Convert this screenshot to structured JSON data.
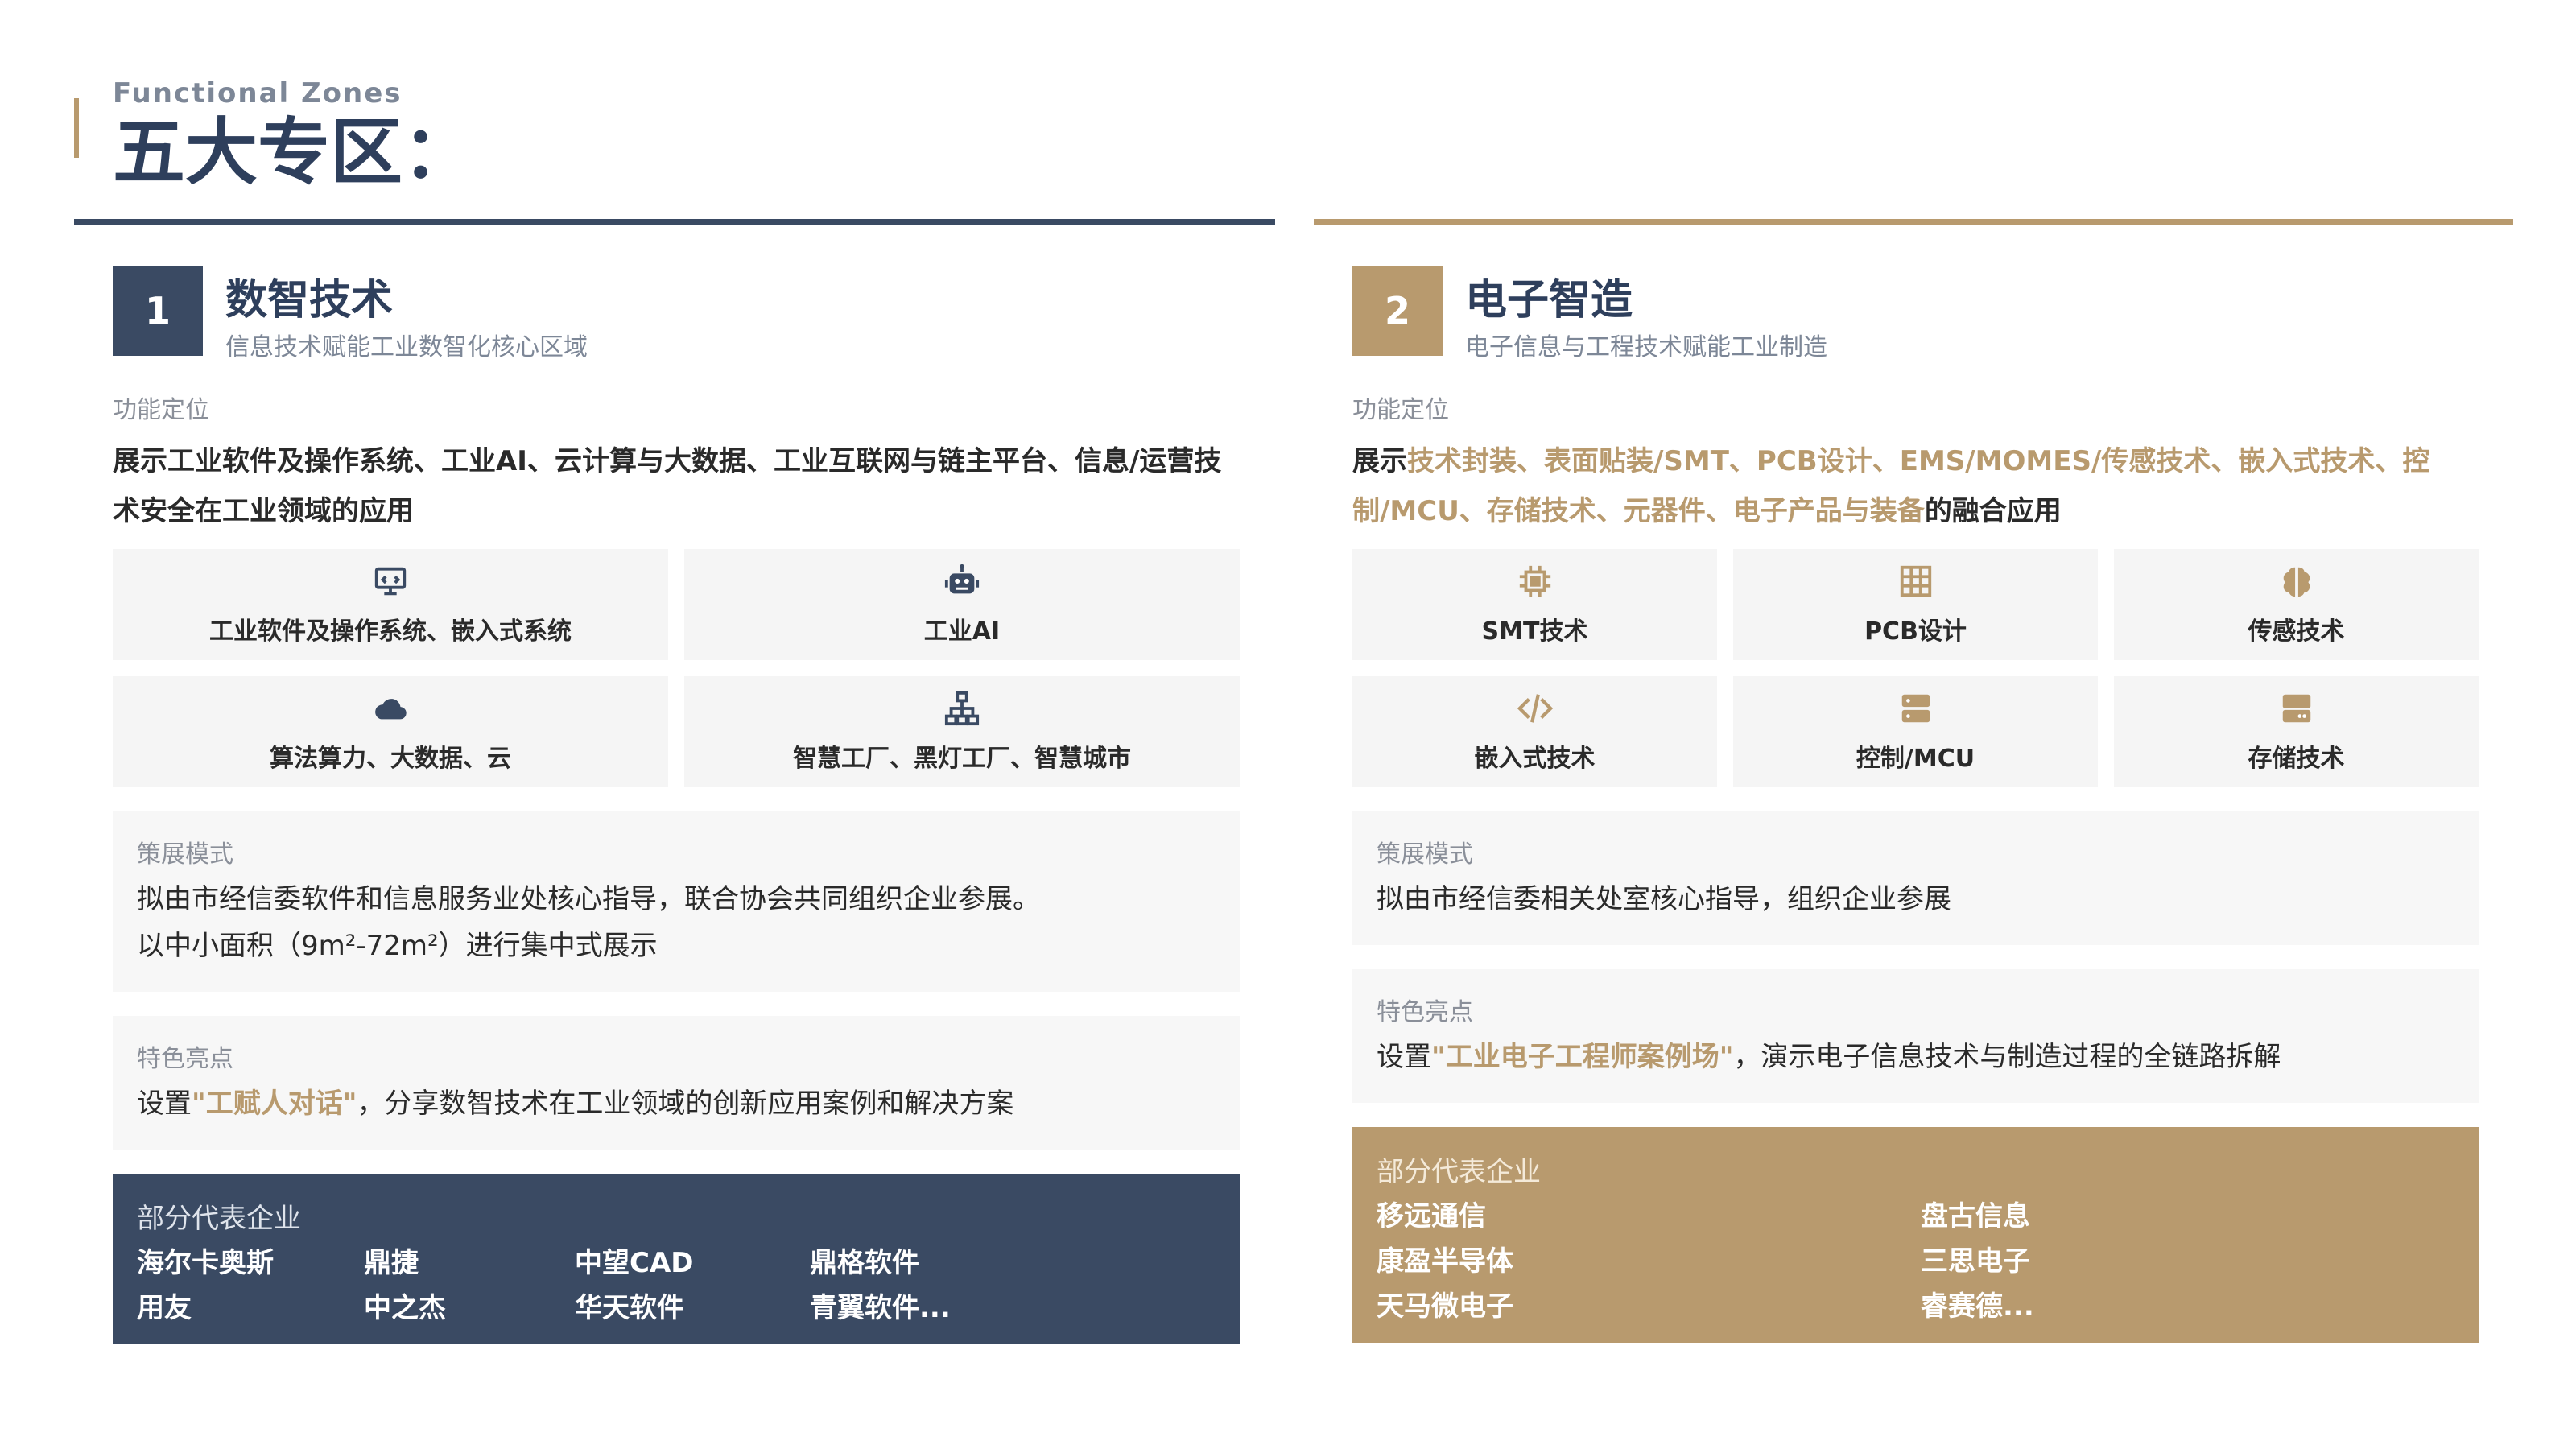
{
  "header": {
    "subtitle": "Functional Zones",
    "title": "五大专区："
  },
  "zone1": {
    "number": "1",
    "title": "数智技术",
    "desc": "信息技术赋能工业数智化核心区域",
    "func_label": "功能定位",
    "func_text": "展示工业软件及操作系统、工业AI、云计算与大数据、工业互联网与链主平台、信息/运营技术安全在工业领域的应用",
    "tiles": [
      {
        "icon": "monitor-code-icon",
        "label": "工业软件及操作系统、嵌入式系统"
      },
      {
        "icon": "robot-icon",
        "label": "工业AI"
      },
      {
        "icon": "cloud-icon",
        "label": "算法算力、大数据、云"
      },
      {
        "icon": "network-icon",
        "label": "智慧工厂、黑灯工厂、智慧城市"
      }
    ],
    "mode_label": "策展模式",
    "mode_line1": "拟由市经信委软件和信息服务业处核心指导，联合协会共同组织企业参展。",
    "mode_line2": "以中小面积（9m²-72m²）进行集中式展示",
    "feature_label": "特色亮点",
    "feature_prefix": "设置",
    "feature_highlight": "\"工赋人对话\"",
    "feature_suffix": "，分享数智技术在工业领域的创新应用案例和解决方案",
    "ent_label": "部分代表企业",
    "enterprises": [
      "海尔卡奥斯",
      "鼎捷",
      "中望CAD",
      "鼎格软件",
      "用友",
      "中之杰",
      "华天软件",
      "青翼软件..."
    ]
  },
  "zone2": {
    "number": "2",
    "title": "电子智造",
    "desc": "电子信息与工程技术赋能工业制造",
    "func_label": "功能定位",
    "func_prefix": "展示",
    "func_highlight": "技术封装、表面贴装/SMT、PCB设计、EMS/MOMES/传感技术、嵌入式技术、控制/MCU、存储技术、元器件、电子产品与装备",
    "func_suffix": "的融合应用",
    "tiles": [
      {
        "icon": "chip-icon",
        "label": "SMT技术"
      },
      {
        "icon": "grid-board-icon",
        "label": "PCB设计"
      },
      {
        "icon": "brain-icon",
        "label": "传感技术"
      },
      {
        "icon": "code-icon",
        "label": "嵌入式技术"
      },
      {
        "icon": "server-icon",
        "label": "控制/MCU"
      },
      {
        "icon": "storage-icon",
        "label": "存储技术"
      }
    ],
    "mode_label": "策展模式",
    "mode_line1": "拟由市经信委相关处室核心指导，组织企业参展",
    "feature_label": "特色亮点",
    "feature_prefix": "设置",
    "feature_highlight": "\"工业电子工程师案例场\"",
    "feature_suffix": "，演示电子信息技术与制造过程的全链路拆解",
    "ent_label": "部分代表企业",
    "enterprises": [
      "移远通信",
      "盘古信息",
      "康盈半导体",
      "三思电子",
      "天马微电子",
      "睿赛德..."
    ]
  },
  "colors": {
    "navy": "#3a4a63",
    "gold": "#b89a6e",
    "tile_bg": "#f5f5f5"
  }
}
